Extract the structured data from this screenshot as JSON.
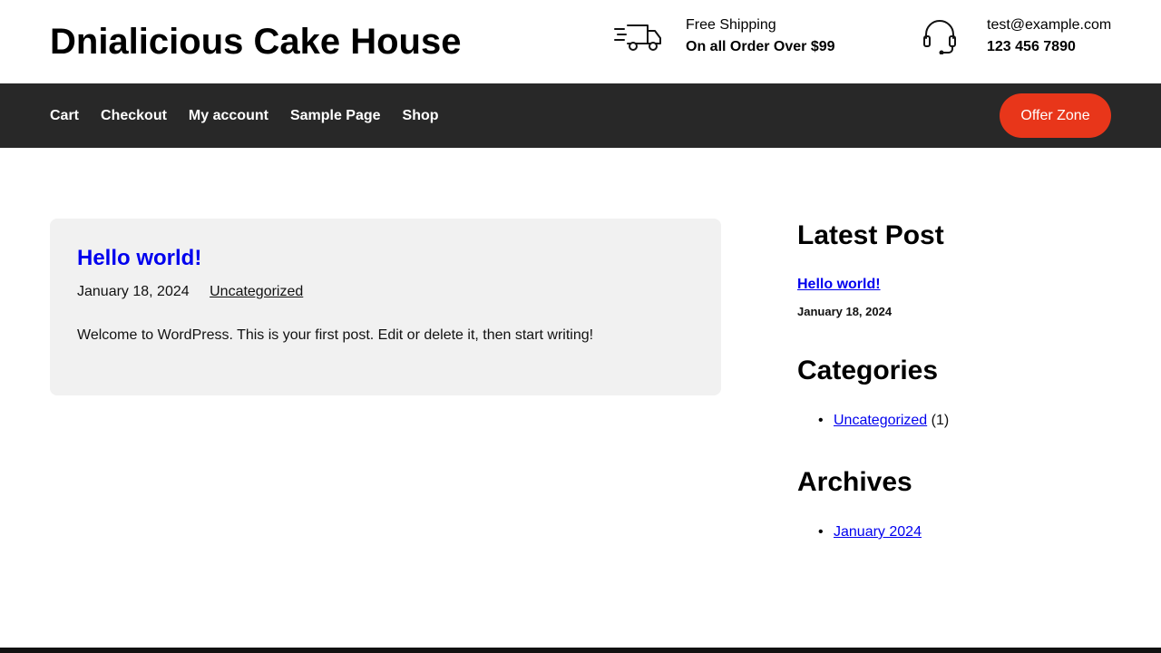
{
  "header": {
    "site_title": "Dnialicious Cake House",
    "shipping": {
      "icon": "delivery-truck-icon",
      "line1": "Free Shipping",
      "line2": "On all Order Over $99"
    },
    "contact": {
      "icon": "headset-icon",
      "email": "test@example.com",
      "phone": "123 456 7890"
    }
  },
  "nav": {
    "links": [
      "Cart",
      "Checkout",
      "My account",
      "Sample Page",
      "Shop"
    ],
    "offer_button": "Offer Zone"
  },
  "post": {
    "title": "Hello world!",
    "date": "January 18, 2024",
    "category": "Uncategorized",
    "excerpt": "Welcome to WordPress. This is your first post. Edit or delete it, then start writing!"
  },
  "sidebar": {
    "latest": {
      "title": "Latest Post",
      "post_title": "Hello world!",
      "post_date": "January 18, 2024"
    },
    "categories": {
      "title": "Categories",
      "items": [
        {
          "name": "Uncategorized",
          "count": "(1)"
        }
      ]
    },
    "archives": {
      "title": "Archives",
      "items": [
        "January 2024"
      ]
    }
  },
  "colors": {
    "nav_bg": "#282828",
    "accent": "#e8361a",
    "card_bg": "#f1f1f1",
    "link": "#0000ee"
  }
}
